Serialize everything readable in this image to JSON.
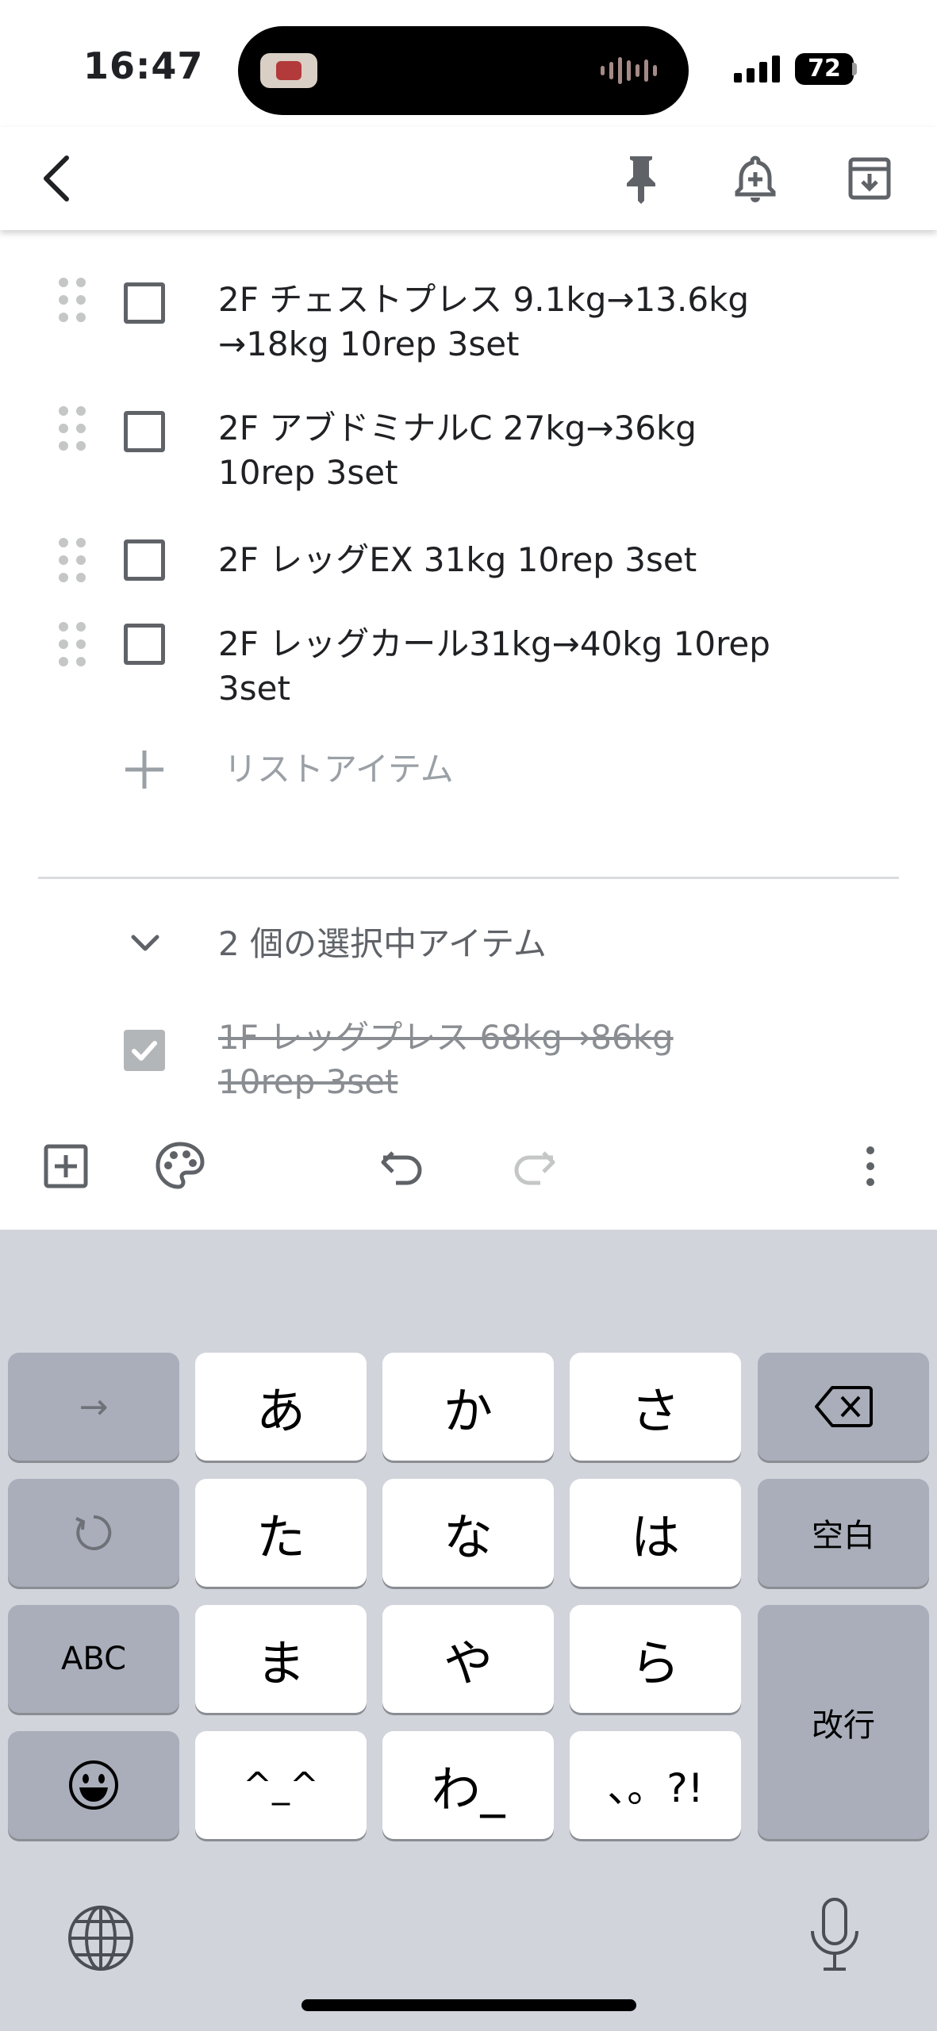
{
  "status_bar": {
    "time": "16:47",
    "battery": "72"
  },
  "list": {
    "items": [
      {
        "text_line1": "2F チェストプレス 9.1kg→13.6kg",
        "text_line2": "→18kg 10rep 3set",
        "checked": false
      },
      {
        "text_line1": "2F アブドミナルC 27kg→36kg",
        "text_line2": "10rep 3set",
        "checked": false
      },
      {
        "text_line1": "2F レッグEX 31kg 10rep 3set",
        "text_line2": "",
        "checked": false
      },
      {
        "text_line1": "2F レッグカール31kg→40kg 10rep",
        "text_line2": "3set",
        "checked": false
      }
    ],
    "add_placeholder": "リストアイテム",
    "checked_header": "2 個の選択中アイテム",
    "checked_items": [
      {
        "text_line1": "1F レッグプレス 68kg→86kg",
        "text_line2": "10rep 3set",
        "checked": true
      }
    ]
  },
  "keyboard": {
    "keys": {
      "arrow": "→",
      "a": "あ",
      "ka": "か",
      "sa": "さ",
      "ta": "た",
      "na": "な",
      "ha": "は",
      "ma": "ま",
      "ya": "や",
      "ra": "ら",
      "kaomoji": "^_^",
      "wa": "わ_",
      "punct": "、。?!",
      "space": "空白",
      "abc": "ABC",
      "enter": "改行"
    }
  },
  "colors": {
    "keyboard_bg": "#d1d4db",
    "dark_key": "#a9aeba",
    "checked_box": "#b3b6b9"
  },
  "icons": [
    "back-arrow-icon",
    "pin-icon",
    "add-reminder-icon",
    "archive-icon",
    "add-box-icon",
    "palette-icon",
    "undo-icon",
    "redo-icon",
    "more-vert-icon",
    "drag-handle-icon",
    "backspace-icon",
    "undo-kana-icon",
    "emoji-icon",
    "globe-icon",
    "microphone-icon"
  ]
}
